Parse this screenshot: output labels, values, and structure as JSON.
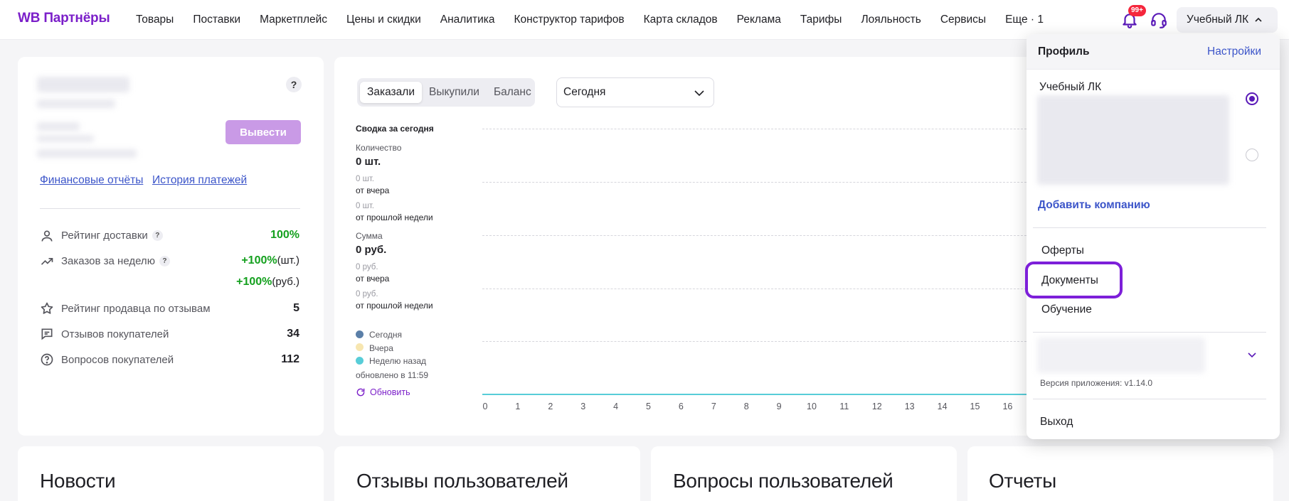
{
  "brand": {
    "logo": "WB Партнёры",
    "accent": "#7b1fc9"
  },
  "nav": {
    "items": [
      "Товары",
      "Поставки",
      "Маркетплейс",
      "Цены и скидки",
      "Аналитика",
      "Конструктор тарифов",
      "Карта складов",
      "Реклама",
      "Тарифы",
      "Лояльность",
      "Сервисы",
      "Еще · 1"
    ]
  },
  "header": {
    "notifications_badge": "99+",
    "account_label": "Учебный ЛК"
  },
  "finance": {
    "help": "?",
    "withdraw_label": "Вывести",
    "links": [
      "Финансовые отчёты",
      "История платежей"
    ]
  },
  "metrics": [
    {
      "label": "Рейтинг доставки",
      "value": "100%",
      "help": true,
      "icon": "user-icon"
    },
    {
      "label": "Заказов за неделю",
      "value": "+100%",
      "unit": "(шт.)",
      "value2": "+100%",
      "unit2": "(руб.)",
      "help": true,
      "icon": "trend-up-icon"
    },
    {
      "label": "Рейтинг продавца по отзывам",
      "value": "5",
      "icon": "star-icon"
    },
    {
      "label": "Отзывов покупателей",
      "value": "34",
      "icon": "comment-icon"
    },
    {
      "label": "Вопросов покупателей",
      "value": "112",
      "icon": "question-circle-icon"
    }
  ],
  "summary": {
    "tabs": [
      "Заказали",
      "Выкупили",
      "Баланс"
    ],
    "active_tab": "Заказали",
    "period_value": "Сегодня",
    "title": "Сводка за сегодня",
    "quantity_label": "Количество",
    "quantity_value": "0 шт.",
    "qty_yesterday_value": "0 шт.",
    "qty_yesterday_label": "от вчера",
    "qty_week_value": "0 шт.",
    "qty_week_label": "от прошлой недели",
    "sum_label": "Сумма",
    "sum_value": "0 руб.",
    "sum_yesterday_value": "0 руб.",
    "sum_yesterday_label": "от вчера",
    "sum_week_value": "0 руб.",
    "sum_week_label": "от прошлой недели",
    "updated": "обновлено в 11:59",
    "refresh_label": "Обновить"
  },
  "chart_data": {
    "type": "line",
    "x": [
      0,
      1,
      2,
      3,
      4,
      5,
      6,
      7,
      8,
      9,
      10,
      11,
      12,
      13,
      14,
      15,
      16
    ],
    "series": [
      {
        "name": "Сегодня",
        "color": "#5b7fa8",
        "values": [
          0,
          0,
          0,
          0,
          0,
          0,
          0,
          0,
          0,
          0,
          0,
          0,
          0,
          0,
          0,
          0,
          0
        ]
      },
      {
        "name": "Вчера",
        "color": "#f7e6b0",
        "values": [
          0,
          0,
          0,
          0,
          0,
          0,
          0,
          0,
          0,
          0,
          0,
          0,
          0,
          0,
          0,
          0,
          0
        ]
      },
      {
        "name": "Неделю назад",
        "color": "#58cdd8",
        "values": [
          0,
          0,
          0,
          0,
          0,
          0,
          0,
          0,
          0,
          0,
          0,
          0,
          0,
          0,
          0,
          0,
          0
        ]
      }
    ],
    "grid": true,
    "legend": "left"
  },
  "bottom_cards": [
    "Новости",
    "Отзывы пользователей",
    "Вопросы пользователей",
    "Отчеты"
  ],
  "profile_menu": {
    "title": "Профиль",
    "settings_label": "Настройки",
    "company_name": "Учебный ЛК",
    "add_company_label": "Добавить компанию",
    "items": [
      "Оферты",
      "Документы",
      "Обучение"
    ],
    "highlighted_item": "Документы",
    "version": "Версия приложения: v1.14.0",
    "logout_label": "Выход"
  }
}
